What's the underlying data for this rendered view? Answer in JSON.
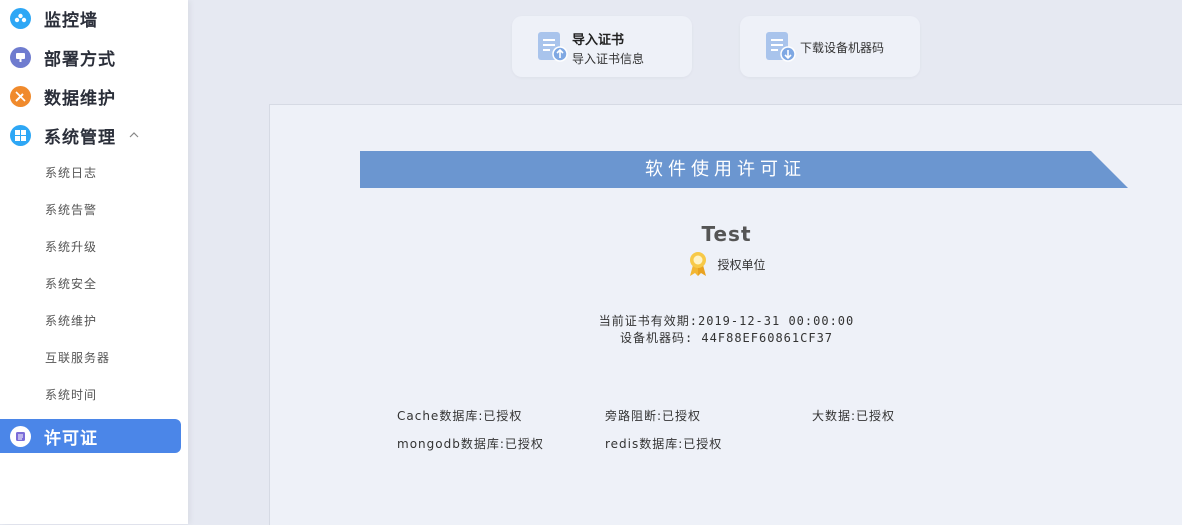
{
  "sidebar": {
    "main_items": [
      {
        "label": "监控墙",
        "icon": "monitor-wall-icon",
        "color": "#2ea7f5"
      },
      {
        "label": "部署方式",
        "icon": "deploy-icon",
        "color": "#6f7ccf"
      },
      {
        "label": "数据维护",
        "icon": "tools-icon",
        "color": "#f08a2c"
      },
      {
        "label": "系统管理",
        "icon": "windows-icon",
        "color": "#2ea7f5"
      }
    ],
    "sub_items": [
      "系统日志",
      "系统告警",
      "系统升级",
      "系统安全",
      "系统维护",
      "互联服务器",
      "系统时间"
    ],
    "active_item": {
      "label": "许可证",
      "icon": "license-icon"
    },
    "active_color": "#4b86e8"
  },
  "toolbar": {
    "import_title": "导入证书",
    "import_subtitle": "导入证书信息",
    "download_label": "下载设备机器码"
  },
  "license": {
    "banner_title": "软件使用许可证",
    "banner_color": "#6b96d0",
    "organization": "Test",
    "org_caption": "授权单位",
    "validity": "当前证书有效期:2019-12-31 00:00:00",
    "machine_code": "设备机器码: 44F88EF60861CF37",
    "features": [
      [
        "Cache数据库:已授权",
        "旁路阻断:已授权",
        "大数据:已授权"
      ],
      [
        "mongodb数据库:已授权",
        "redis数据库:已授权"
      ]
    ]
  }
}
